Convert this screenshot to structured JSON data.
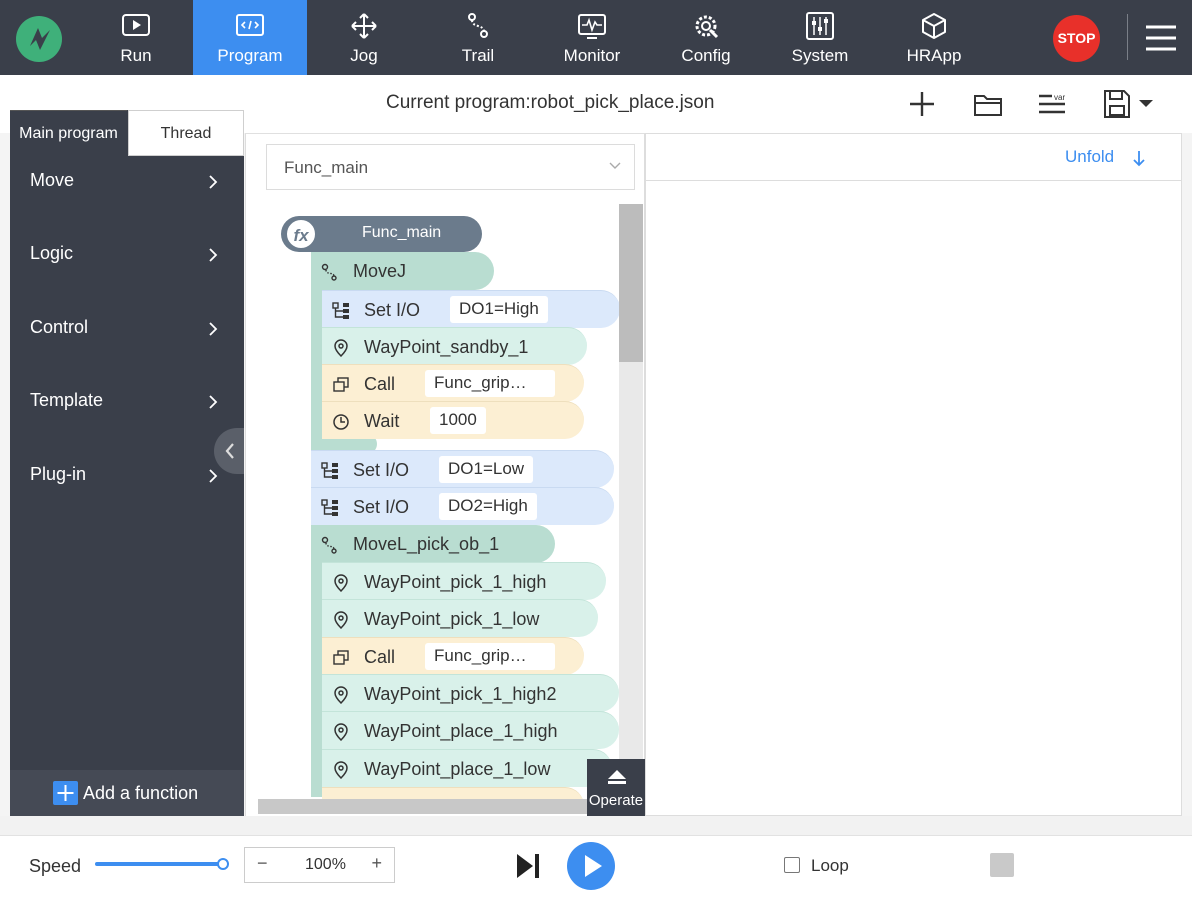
{
  "nav": {
    "items": [
      {
        "label": "Run",
        "icon": "play-screen-icon"
      },
      {
        "label": "Program",
        "icon": "code-screen-icon",
        "active": true
      },
      {
        "label": "Jog",
        "icon": "move-arrows-icon"
      },
      {
        "label": "Trail",
        "icon": "trail-path-icon"
      },
      {
        "label": "Monitor",
        "icon": "monitor-wave-icon"
      },
      {
        "label": "Config",
        "icon": "gear-tools-icon"
      },
      {
        "label": "System",
        "icon": "sliders-icon"
      },
      {
        "label": "HRApp",
        "icon": "cube-icon"
      }
    ],
    "stop_label": "STOP"
  },
  "header": {
    "title": "Current program:robot_pick_place.json"
  },
  "left_panel": {
    "tabs": [
      "Main program",
      "Thread"
    ],
    "categories": [
      "Move",
      "Logic",
      "Control",
      "Template",
      "Plug-in"
    ],
    "add_function": "Add a function"
  },
  "program": {
    "selected_function": "Func_main",
    "func_head": "Func_main",
    "blocks": [
      {
        "type": "move",
        "label": "MoveJ"
      },
      {
        "type": "io",
        "label": "Set I/O",
        "value": "DO1=High"
      },
      {
        "type": "waypoint",
        "label": "WayPoint_sandby_1"
      },
      {
        "type": "call",
        "label": "Call",
        "value": "Func_grip…"
      },
      {
        "type": "wait",
        "label": "Wait",
        "value": "1000"
      },
      {
        "type": "io",
        "label": "Set I/O",
        "value": "DO1=Low"
      },
      {
        "type": "io",
        "label": "Set I/O",
        "value": "DO2=High"
      },
      {
        "type": "move",
        "label": "MoveL_pick_ob_1"
      },
      {
        "type": "waypoint",
        "label": "WayPoint_pick_1_high"
      },
      {
        "type": "waypoint",
        "label": "WayPoint_pick_1_low"
      },
      {
        "type": "call",
        "label": "Call",
        "value": "Func_grip…"
      },
      {
        "type": "waypoint",
        "label": "WayPoint_pick_1_high2"
      },
      {
        "type": "waypoint",
        "label": "WayPoint_place_1_high"
      },
      {
        "type": "waypoint",
        "label": "WayPoint_place_1_low"
      }
    ],
    "operate_label": "Operate"
  },
  "right_panel": {
    "unfold_label": "Unfold"
  },
  "bottom": {
    "speed_label": "Speed",
    "speed_value": "100%",
    "speed_fraction": 1.0,
    "loop_label": "Loop",
    "loop_checked": false
  },
  "colors": {
    "nav_bg": "#3a3f4a",
    "accent": "#3d8ef0",
    "stop": "#e8302a",
    "move_block": "#b9ddd1",
    "io_block": "#dce9fb",
    "call_block": "#fcefd3"
  }
}
